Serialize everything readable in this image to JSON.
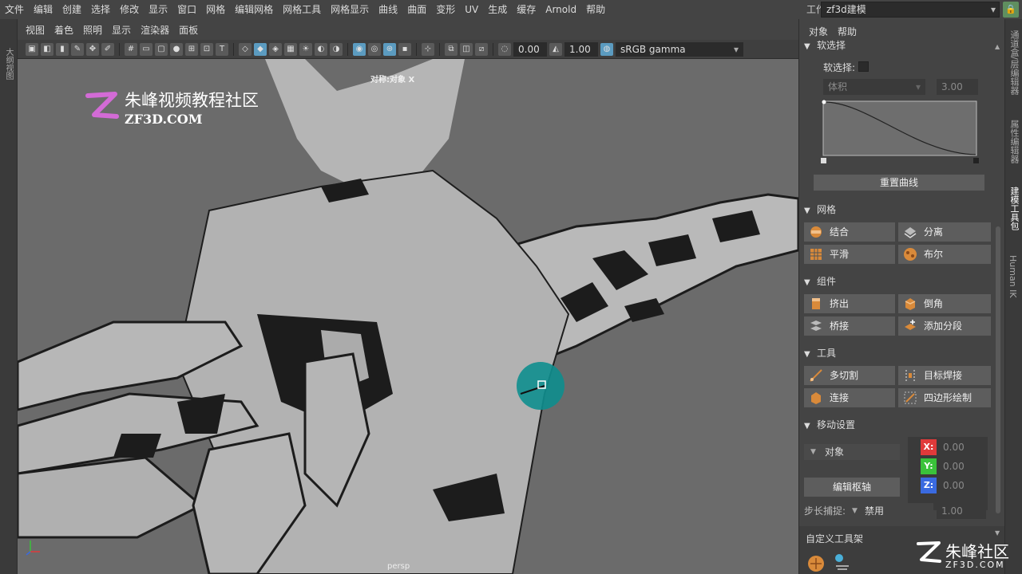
{
  "menu": [
    "文件",
    "编辑",
    "创建",
    "选择",
    "修改",
    "显示",
    "窗口",
    "网格",
    "编辑网格",
    "网格工具",
    "网格显示",
    "曲线",
    "曲面",
    "变形",
    "UV",
    "生成",
    "缓存",
    "Arnold",
    "帮助"
  ],
  "workspace": {
    "label": "工作区:",
    "value": "zf3d建模"
  },
  "left_tab": "大纲视图",
  "viewport": {
    "menu": [
      "视图",
      "着色",
      "照明",
      "显示",
      "渲染器",
      "面板"
    ],
    "exposure": "0.00",
    "gamma": "1.00",
    "colorspace": "sRGB gamma",
    "symmetry_label": "对称:对象 X",
    "camera_label": "persp",
    "watermark_title": "朱峰视频教程社区",
    "watermark_url": "ZF3D.COM"
  },
  "panel": {
    "menu": [
      "对象",
      "帮助"
    ],
    "soft_select": {
      "header": "软选择",
      "toggle_label": "软选择:",
      "falloff_mode": "体积",
      "falloff_radius": "3.00",
      "reset_curve": "重置曲线"
    },
    "mesh": {
      "header": "网格",
      "buttons": [
        "结合",
        "分离",
        "平滑",
        "布尔"
      ]
    },
    "components": {
      "header": "组件",
      "buttons": [
        "挤出",
        "倒角",
        "桥接",
        "添加分段"
      ]
    },
    "tools": {
      "header": "工具",
      "buttons": [
        "多切割",
        "目标焊接",
        "连接",
        "四边形绘制"
      ]
    },
    "move": {
      "header": "移动设置",
      "space": "对象",
      "edit_pivot": "编辑枢轴",
      "x": "0.00",
      "y": "0.00",
      "z": "0.00",
      "step_label": "步长捕捉:",
      "step_mode": "禁用",
      "step_value": "1.00"
    },
    "shelf_header": "自定义工具架"
  },
  "right_tabs": [
    "通道盒/层编辑器",
    "属性编辑器",
    "建模工具包",
    "Human IK"
  ],
  "bottom_logo": {
    "text": "朱峰社区",
    "url": "ZF3D.COM"
  },
  "colors": {
    "accent": "#5b9bc0",
    "x": "#e03a3a",
    "y": "#3ac23a",
    "z": "#3a6ae0",
    "cursor": "#0e8e8e"
  }
}
